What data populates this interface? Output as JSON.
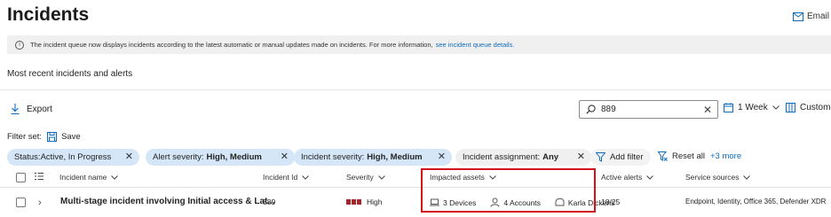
{
  "header": {
    "title": "Incidents",
    "email_label": "Email"
  },
  "banner": {
    "text": "The incident queue now displays incidents according to the latest automatic or manual updates made on incidents. For more information,",
    "link": "see incident queue details."
  },
  "section_title": "Most recent incidents and alerts",
  "toolbar": {
    "export_label": "Export",
    "search_value": "889",
    "range_label": "1 Week",
    "custom_label": "Customi"
  },
  "filter_set": {
    "label": "Filter set:",
    "save_label": "Save"
  },
  "chips": [
    {
      "key": "Status:",
      "value": "Active, In Progress"
    },
    {
      "key": "Alert severity:",
      "value": "High, Medium"
    },
    {
      "key": "Incident severity:",
      "value": "High, Medium"
    },
    {
      "key": "Incident assignment:",
      "value": "Any"
    }
  ],
  "filter_actions": {
    "add_filter": "Add filter",
    "reset_all": "Reset all",
    "more": "+3 more"
  },
  "table": {
    "columns": {
      "incident_name": "Incident name",
      "incident_id": "Incident Id",
      "severity": "Severity",
      "impacted_assets": "Impacted assets",
      "active_alerts": "Active alerts",
      "service_sources": "Service sources"
    },
    "rows": [
      {
        "name": "Multi-stage incident involving Initial access & Lat...",
        "id": "889",
        "severity": "High",
        "devices": "3 Devices",
        "accounts": "4 Accounts",
        "user": "Karla Dickens",
        "active_alerts": "18/25",
        "service_sources": "Endpoint, Identity, Office 365, Defender XDR"
      }
    ]
  },
  "colors": {
    "accent": "#0f6cbd",
    "chip": "#d4e6f7",
    "severity_high": "#a4262c",
    "highlight": "#d3121c"
  }
}
